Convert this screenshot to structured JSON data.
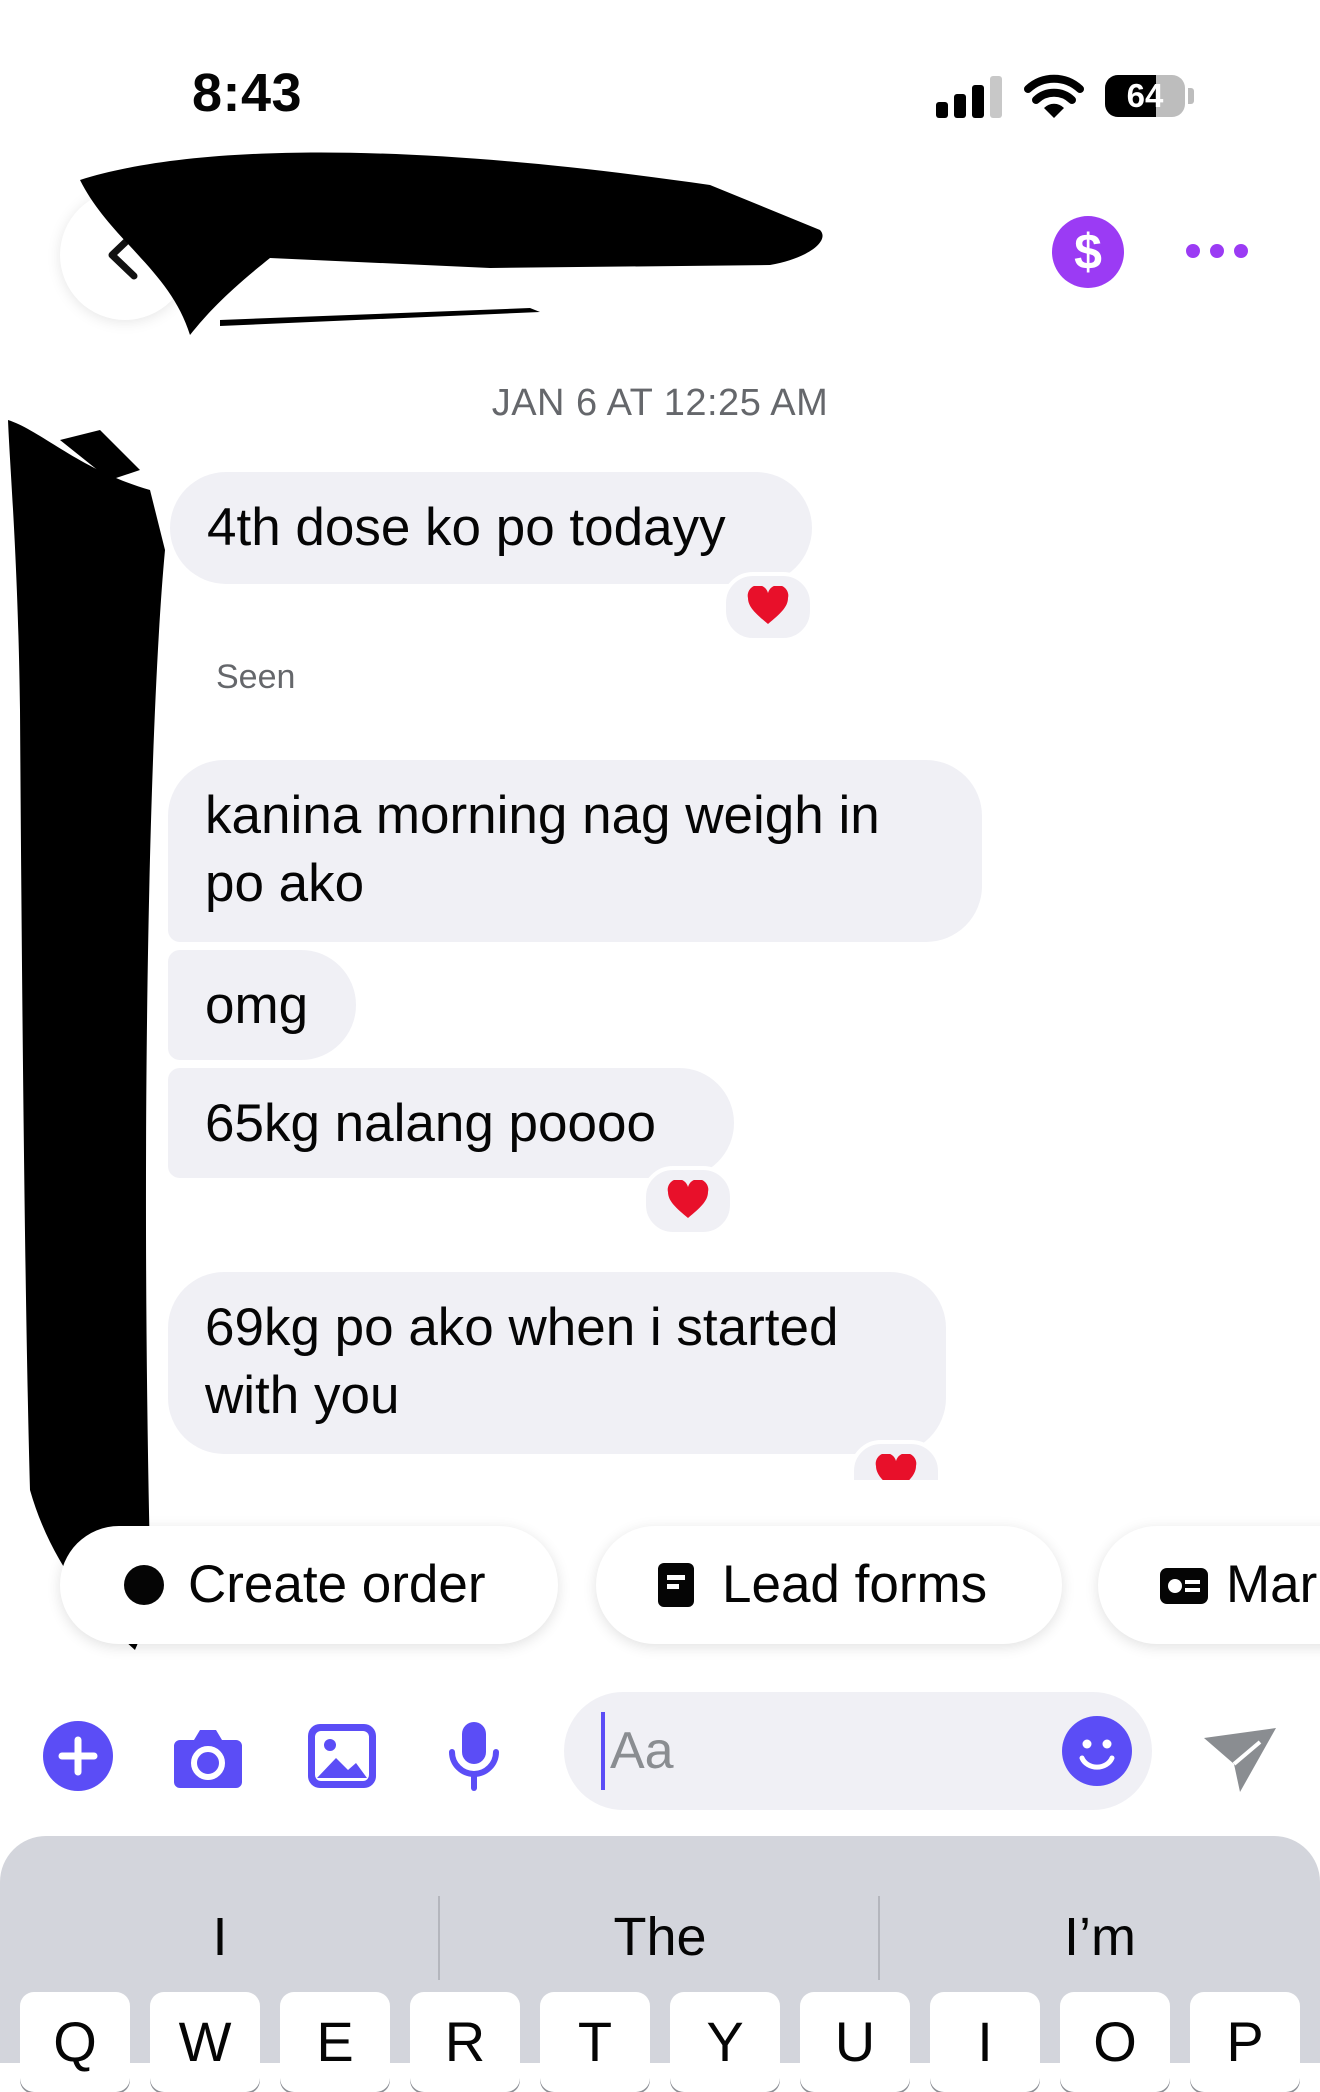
{
  "status_bar": {
    "time": "8:43",
    "battery_percent": 64,
    "battery_text": "64",
    "signal_bars": 3
  },
  "header": {
    "icons": [
      "back-icon",
      "dollar-icon",
      "more-icon"
    ],
    "accent_color": "#9b3bf4"
  },
  "chat": {
    "date_label": "JAN 6 AT 12:25 AM",
    "seen_label": "Seen",
    "messages": [
      {
        "text": "4th dose ko po todayy",
        "reaction": "heart"
      },
      {
        "text": "kanina morning nag weigh in po ako",
        "reaction": ""
      },
      {
        "text": "omg",
        "reaction": ""
      },
      {
        "text": "65kg nalang poooo",
        "reaction": "heart"
      },
      {
        "text": "69kg po ako when i started with you",
        "reaction": "heart"
      }
    ]
  },
  "quick_actions": [
    {
      "label": "Create order",
      "icon": "dollar-circle-icon"
    },
    {
      "label": "Lead forms",
      "icon": "form-icon"
    },
    {
      "label": "Mar",
      "icon": "card-icon"
    }
  ],
  "composer": {
    "placeholder": "Aa",
    "tools": [
      "plus-icon",
      "camera-icon",
      "gallery-icon",
      "microphone-icon",
      "emoji-icon",
      "send-icon"
    ],
    "accent_color": "#5b4df6"
  },
  "keyboard": {
    "suggestions": [
      "I",
      "The",
      "I’m"
    ],
    "row1": [
      "Q",
      "W",
      "E",
      "R",
      "T",
      "Y",
      "U",
      "I",
      "O",
      "P"
    ]
  }
}
